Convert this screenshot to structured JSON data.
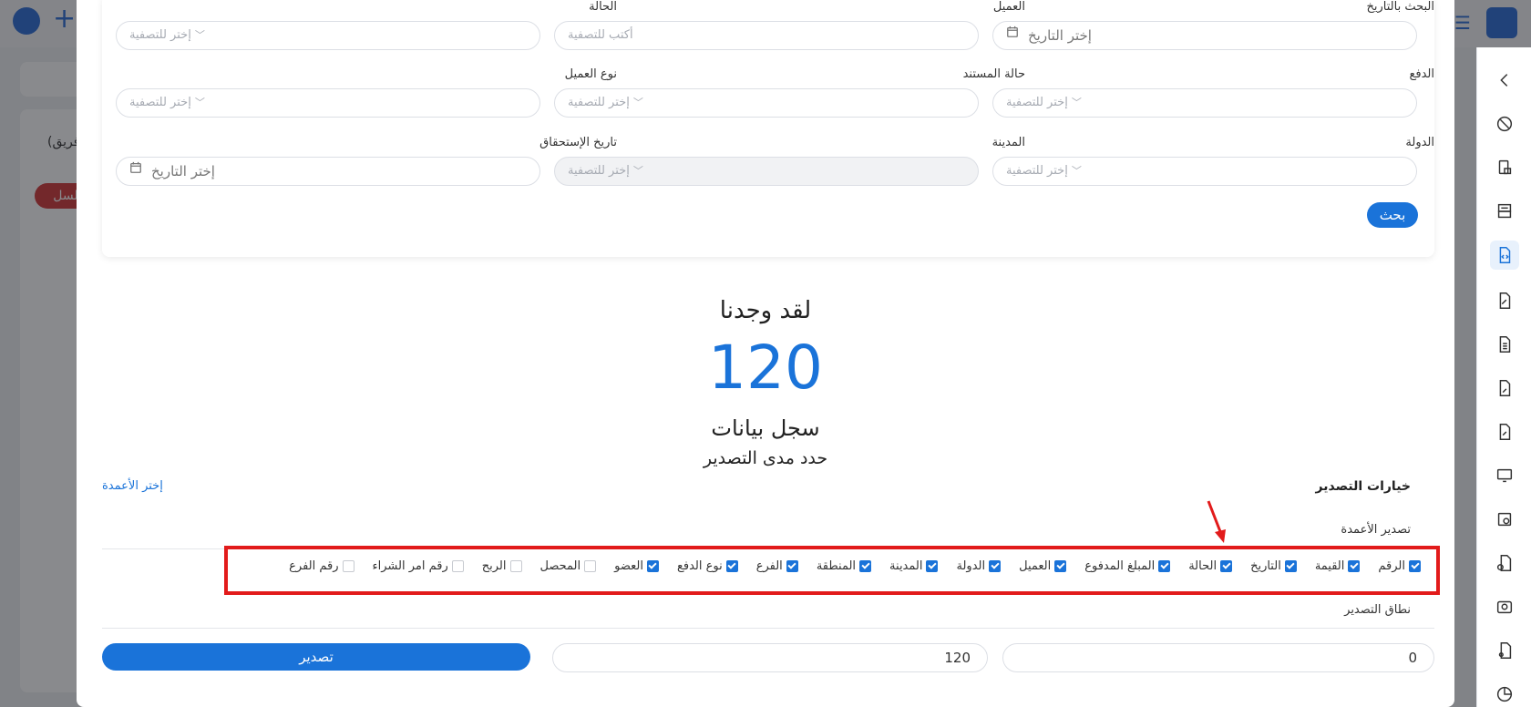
{
  "filters": {
    "date_search": {
      "label": "البحث بالتاريخ",
      "placeholder": "إختر التاريخ"
    },
    "client": {
      "label": "العميل",
      "placeholder": "أكتب للتصفية"
    },
    "status": {
      "label": "الحالة",
      "placeholder": "إختر للتصفية"
    },
    "payment": {
      "label": "الدفع",
      "placeholder": "إختر للتصفية"
    },
    "doc_status": {
      "label": "حالة المستند",
      "placeholder": "إختر للتصفية"
    },
    "client_type": {
      "label": "نوع العميل",
      "placeholder": "إختر للتصفية"
    },
    "country": {
      "label": "الدولة",
      "placeholder": "إختر للتصفية"
    },
    "city": {
      "label": "المدينة",
      "placeholder": "إختر للتصفية"
    },
    "due_date": {
      "label": "تاريخ الإستحقاق",
      "placeholder": "إختر التاريخ"
    },
    "search_button": "بحث"
  },
  "results": {
    "found_label": "لقد وجدنا",
    "count": "120",
    "records_label": "سجل بيانات",
    "range_prompt": "حدد مدى التصدير"
  },
  "export": {
    "options_title": "خيارات التصدير",
    "choose_columns_link": "إختر الأعمدة",
    "columns_label": "تصدير الأعمدة",
    "columns": [
      {
        "label": "الرقم",
        "checked": true
      },
      {
        "label": "القيمة",
        "checked": true
      },
      {
        "label": "التاريخ",
        "checked": true
      },
      {
        "label": "الحالة",
        "checked": true
      },
      {
        "label": "المبلغ المدفوع",
        "checked": true
      },
      {
        "label": "العميل",
        "checked": true
      },
      {
        "label": "الدولة",
        "checked": true
      },
      {
        "label": "المدينة",
        "checked": true
      },
      {
        "label": "المنطقة",
        "checked": true
      },
      {
        "label": "الفرع",
        "checked": true
      },
      {
        "label": "نوع الدفع",
        "checked": true
      },
      {
        "label": "العضو",
        "checked": true
      },
      {
        "label": "المحصل",
        "checked": false
      },
      {
        "label": "الربح",
        "checked": false
      },
      {
        "label": "رقم امر الشراء",
        "checked": false
      },
      {
        "label": "رقم الفرع",
        "checked": false
      }
    ],
    "range_label": "نطاق التصدير",
    "range_from": "0",
    "range_to": "120",
    "export_button": "تصدير"
  },
  "background": {
    "filter_text": "فريق)",
    "pill_text": "سلسل"
  },
  "sidebar_icons": [
    "chevron-left-icon",
    "palette-icon",
    "invoice-icon",
    "printer-icon",
    "document-code-icon",
    "document-edit-icon",
    "document-list-icon",
    "document-pen-icon",
    "document-sign-icon",
    "monitor-icon",
    "image-add-icon",
    "document-add-icon",
    "camera-icon",
    "document-user-icon",
    "chart-icon"
  ],
  "colors": {
    "accent": "#1a73d9",
    "highlight_box": "#e21b1b"
  }
}
